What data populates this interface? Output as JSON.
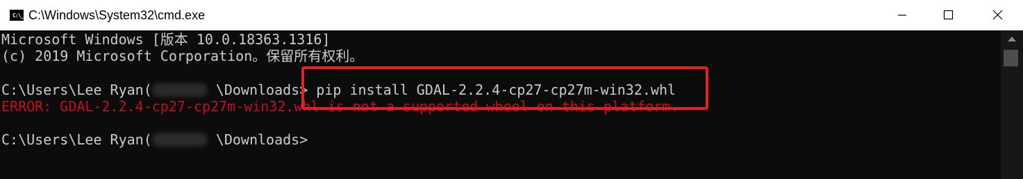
{
  "window": {
    "title": "C:\\Windows\\System32\\cmd.exe",
    "icon": "cmd-icon",
    "icon_text": "C:\\_"
  },
  "console": {
    "lines": [
      {
        "text": "Microsoft Windows [版本 10.0.18363.1316]",
        "type": "normal"
      },
      {
        "text": "(c) 2019 Microsoft Corporation。保留所有权利。",
        "type": "normal"
      },
      {
        "text": "",
        "type": "blank"
      },
      {
        "prefix": "C:\\Users\\Lee Ryan(",
        "redacted": true,
        "suffix": " \\Downloads>",
        "command": " pip install GDAL-2.2.4-cp27-cp27m-win32.whl",
        "type": "prompt"
      },
      {
        "text": "ERROR: GDAL-2.2.4-cp27-cp27m-win32.whl is not a supported wheel on this platform.",
        "type": "error"
      },
      {
        "text": "",
        "type": "blank"
      },
      {
        "prefix": "C:\\Users\\Lee Ryan(",
        "redacted": true,
        "suffix": " \\Downloads>",
        "command": "",
        "type": "prompt"
      }
    ]
  },
  "colors": {
    "background": "#0c0c0c",
    "text": "#cccccc",
    "error": "#c50f1f",
    "highlight": "#e0241b"
  }
}
